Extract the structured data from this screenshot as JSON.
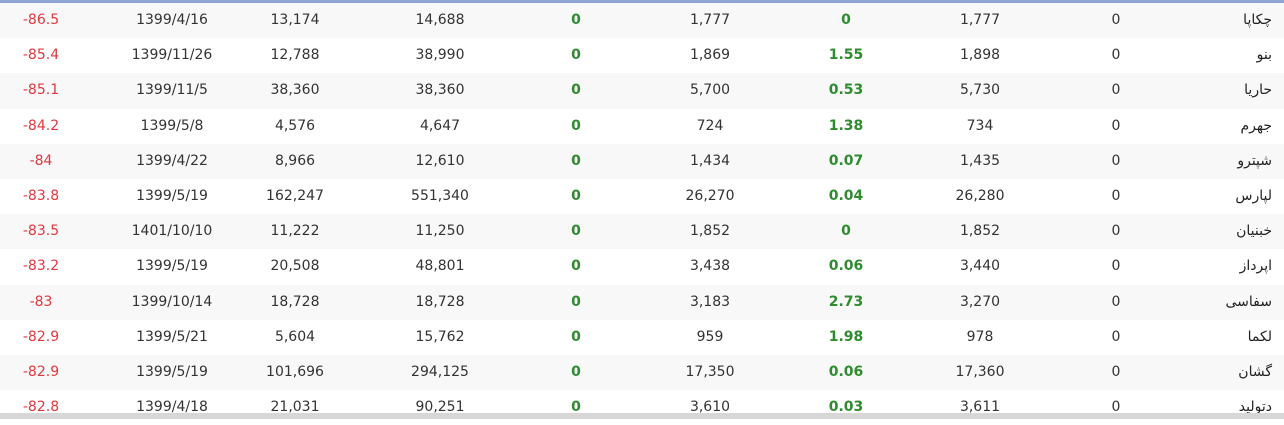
{
  "rows": [
    {
      "pct": "-86.5",
      "date": "1399/4/16",
      "n1": "13,174",
      "n2": "14,688",
      "z1": "0",
      "v1": "1,777",
      "ch": "0",
      "v2": "1,777",
      "z2": "0",
      "name": "چکاپا"
    },
    {
      "pct": "-85.4",
      "date": "1399/11/26",
      "n1": "12,788",
      "n2": "38,990",
      "z1": "0",
      "v1": "1,869",
      "ch": "1.55",
      "v2": "1,898",
      "z2": "0",
      "name": "بنو"
    },
    {
      "pct": "-85.1",
      "date": "1399/11/5",
      "n1": "38,360",
      "n2": "38,360",
      "z1": "0",
      "v1": "5,700",
      "ch": "0.53",
      "v2": "5,730",
      "z2": "0",
      "name": "حاریا"
    },
    {
      "pct": "-84.2",
      "date": "1399/5/8",
      "n1": "4,576",
      "n2": "4,647",
      "z1": "0",
      "v1": "724",
      "ch": "1.38",
      "v2": "734",
      "z2": "0",
      "name": "جهرم"
    },
    {
      "pct": "-84",
      "date": "1399/4/22",
      "n1": "8,966",
      "n2": "12,610",
      "z1": "0",
      "v1": "1,434",
      "ch": "0.07",
      "v2": "1,435",
      "z2": "0",
      "name": "شپترو"
    },
    {
      "pct": "-83.8",
      "date": "1399/5/19",
      "n1": "162,247",
      "n2": "551,340",
      "z1": "0",
      "v1": "26,270",
      "ch": "0.04",
      "v2": "26,280",
      "z2": "0",
      "name": "لپارس"
    },
    {
      "pct": "-83.5",
      "date": "1401/10/10",
      "n1": "11,222",
      "n2": "11,250",
      "z1": "0",
      "v1": "1,852",
      "ch": "0",
      "v2": "1,852",
      "z2": "0",
      "name": "خبنیان"
    },
    {
      "pct": "-83.2",
      "date": "1399/5/19",
      "n1": "20,508",
      "n2": "48,801",
      "z1": "0",
      "v1": "3,438",
      "ch": "0.06",
      "v2": "3,440",
      "z2": "0",
      "name": "اپرداز"
    },
    {
      "pct": "-83",
      "date": "1399/10/14",
      "n1": "18,728",
      "n2": "18,728",
      "z1": "0",
      "v1": "3,183",
      "ch": "2.73",
      "v2": "3,270",
      "z2": "0",
      "name": "سفاسی"
    },
    {
      "pct": "-82.9",
      "date": "1399/5/21",
      "n1": "5,604",
      "n2": "15,762",
      "z1": "0",
      "v1": "959",
      "ch": "1.98",
      "v2": "978",
      "z2": "0",
      "name": "لکما"
    },
    {
      "pct": "-82.9",
      "date": "1399/5/19",
      "n1": "101,696",
      "n2": "294,125",
      "z1": "0",
      "v1": "17,350",
      "ch": "0.06",
      "v2": "17,360",
      "z2": "0",
      "name": "گشان"
    },
    {
      "pct": "-82.8",
      "date": "1399/4/18",
      "n1": "21,031",
      "n2": "90,251",
      "z1": "0",
      "v1": "3,610",
      "ch": "0.03",
      "v2": "3,611",
      "z2": "0",
      "name": "دتولید"
    }
  ]
}
